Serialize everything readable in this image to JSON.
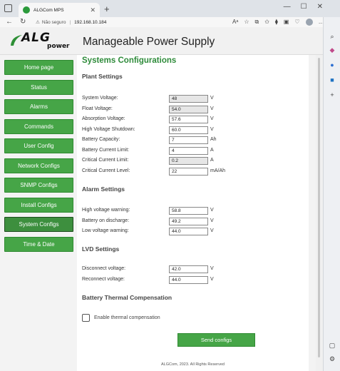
{
  "browser": {
    "tab_title": "ALGCom MPS",
    "url_warning": "Não seguro",
    "url": "192.168.10.184"
  },
  "header": {
    "logo_main": "ALG",
    "logo_sub": "power",
    "title": "Manageable Power Supply"
  },
  "nav": {
    "items": [
      {
        "label": "Home page"
      },
      {
        "label": "Status"
      },
      {
        "label": "Alarms"
      },
      {
        "label": "Commands"
      },
      {
        "label": "User Config"
      },
      {
        "label": "Network Configs"
      },
      {
        "label": "SNMP Configs"
      },
      {
        "label": "Install Configs"
      },
      {
        "label": "System Configs"
      },
      {
        "label": "Time & Date"
      }
    ],
    "active": "System Configs"
  },
  "main": {
    "title": "Systems Configurations",
    "plant": {
      "heading": "Plant Settings",
      "rows": [
        {
          "label": "System Voltage:",
          "value": "48",
          "unit": "V"
        },
        {
          "label": "Float Voltage:",
          "value": "54.0",
          "unit": "V"
        },
        {
          "label": "Absorption Voltage:",
          "value": "57.6",
          "unit": "V"
        },
        {
          "label": "High Voltage Shutdown:",
          "value": "60.0",
          "unit": "V"
        },
        {
          "label": "Battery Capacity:",
          "value": "7",
          "unit": "Ah"
        },
        {
          "label": "Battery Current Limit:",
          "value": "4",
          "unit": "A"
        },
        {
          "label": "Critical Current Limit:",
          "value": "0.2",
          "unit": "A"
        },
        {
          "label": "Critical Current Level:",
          "value": "22",
          "unit": "mA/Ah"
        }
      ]
    },
    "alarm": {
      "heading": "Alarm Settings",
      "rows": [
        {
          "label": "High voltage warning:",
          "value": "58.8",
          "unit": "V"
        },
        {
          "label": "Battery on discharge:",
          "value": "49.2",
          "unit": "V"
        },
        {
          "label": "Low voltage warning:",
          "value": "44.0",
          "unit": "V"
        }
      ]
    },
    "lvd": {
      "heading": "LVD Settings",
      "rows": [
        {
          "label": "Disconnect voltage:",
          "value": "42.0",
          "unit": "V"
        },
        {
          "label": "Reconnect voltage:",
          "value": "44.0",
          "unit": "V"
        }
      ]
    },
    "thermal": {
      "heading": "Battery Thermal Compensation",
      "checkbox_label": "Enable thermal compensation"
    },
    "send_label": "Send configs"
  },
  "footer": {
    "text": "ALGCom, 2023. All Rights Reserved"
  }
}
